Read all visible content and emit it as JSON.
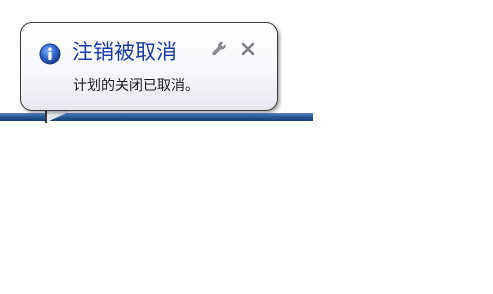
{
  "notification": {
    "title": "注销被取消",
    "message": "计划的关闭已取消。",
    "icon": "info-icon",
    "options_icon": "wrench-icon",
    "close_icon": "close-icon"
  },
  "colors": {
    "title": "#1a3aa8",
    "icon_blue": "#2f63c9",
    "taskbar": "#2d5c9a"
  }
}
